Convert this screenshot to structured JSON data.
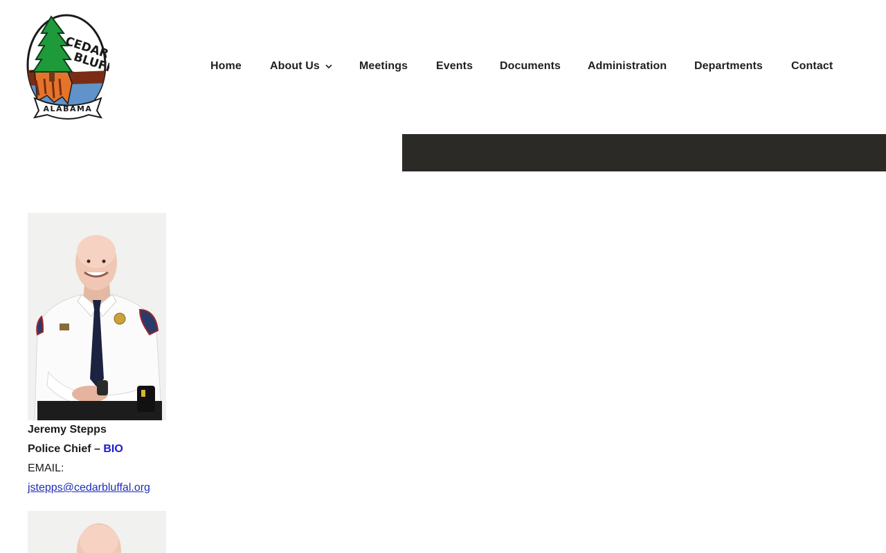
{
  "logo": {
    "top_text": "CEDAR BLUFF",
    "banner_text": "ALABAMA"
  },
  "nav": {
    "items": [
      {
        "label": "Home"
      },
      {
        "label": "About Us",
        "has_dropdown": true
      },
      {
        "label": "Meetings"
      },
      {
        "label": "Events"
      },
      {
        "label": "Documents"
      },
      {
        "label": "Administration"
      },
      {
        "label": "Departments"
      },
      {
        "label": "Contact"
      }
    ]
  },
  "staff": [
    {
      "name": "Jeremy Stepps",
      "title": "Police Chief –",
      "bio_label": "BIO",
      "email_label": "EMAIL:",
      "email": "jstepps@cedarbluffal.org"
    }
  ],
  "colors": {
    "dark_bar": "#2b2a26",
    "bio_link": "#1a1ad4",
    "email_link": "#1d2db8"
  }
}
